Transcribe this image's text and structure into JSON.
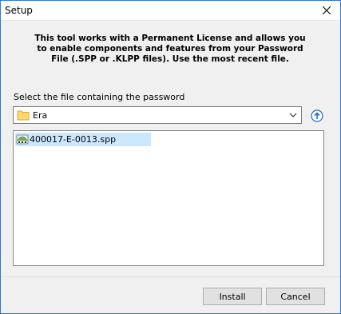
{
  "window": {
    "title": "Setup"
  },
  "intro": {
    "line1": "This tool works with a Permanent License and allows you",
    "line2": "to enable components and features from your Password",
    "line3": "File (.SPP or .KLPP files). Use the most recent file."
  },
  "folder_picker": {
    "label": "Select the file containing the password",
    "selected": "Era"
  },
  "files": [
    {
      "name": "400017-E-0013.spp",
      "icon": "spp-file-icon",
      "selected": true
    }
  ],
  "buttons": {
    "install": "Install",
    "cancel": "Cancel"
  },
  "colors": {
    "selection": "#cce8ff",
    "window_border": "#2b79d3",
    "up_button": "#1f6fc5"
  }
}
